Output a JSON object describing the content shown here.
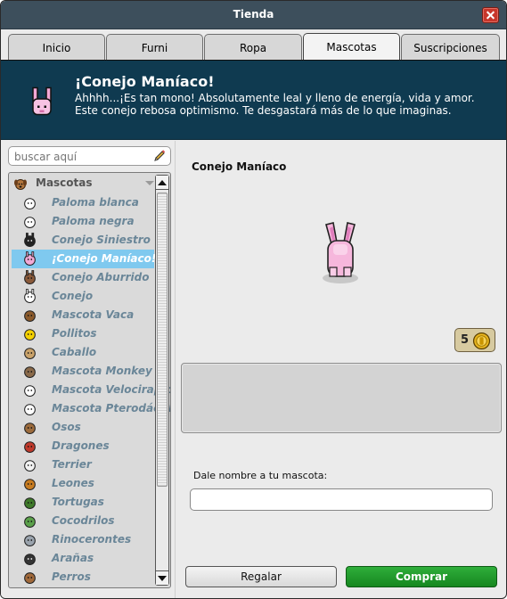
{
  "window": {
    "title": "Tienda"
  },
  "tabs": [
    {
      "label": "Inicio"
    },
    {
      "label": "Furni"
    },
    {
      "label": "Ropa"
    },
    {
      "label": "Mascotas"
    },
    {
      "label": "Suscripciones"
    }
  ],
  "active_tab": "Mascotas",
  "banner": {
    "title": "¡Conejo Maníaco!",
    "description": "Ahhhh...¡Es tan mono! Absolutamente leal y lleno de energía, vida y amor. Este conejo rebosa optimismo. Te desgastará más de lo que imaginas.",
    "icon": "pink-rabbit-icon"
  },
  "search": {
    "placeholder": "buscar aquí",
    "icon": "pencil-icon"
  },
  "category": {
    "label": "Mascotas",
    "icon": "dog-face-icon"
  },
  "items": [
    {
      "label": "Paloma blanca",
      "icon": "white-dove-icon",
      "color": "#ffffff"
    },
    {
      "label": "Paloma negra",
      "icon": "black-dove-icon",
      "color": "#ffffff"
    },
    {
      "label": "Conejo Siniestro",
      "icon": "black-rabbit-icon",
      "color": "#222222"
    },
    {
      "label": "¡Conejo Maníaco!",
      "icon": "pink-rabbit-icon",
      "color": "#f2a9d6",
      "selected": true
    },
    {
      "label": "Conejo Aburrido",
      "icon": "brown-rabbit-icon",
      "color": "#8a5a3a"
    },
    {
      "label": "Conejo",
      "icon": "white-rabbit-icon",
      "color": "#ffffff"
    },
    {
      "label": "Mascota Vaca",
      "icon": "cow-icon",
      "color": "#8b5a2b"
    },
    {
      "label": "Pollitos",
      "icon": "chick-icon",
      "color": "#f4d000"
    },
    {
      "label": "Caballo",
      "icon": "horse-icon",
      "color": "#c9a26a"
    },
    {
      "label": "Mascota Monkey",
      "icon": "monkey-icon",
      "color": "#8a6a4a"
    },
    {
      "label": "Mascota Velociraptor",
      "icon": "velociraptor-icon",
      "color": "#ffffff"
    },
    {
      "label": "Mascota Pterodáctilo",
      "icon": "pterodactyl-icon",
      "color": "#ffffff"
    },
    {
      "label": "Osos",
      "icon": "bear-icon",
      "color": "#9c6b3c"
    },
    {
      "label": "Dragones",
      "icon": "dragon-icon",
      "color": "#c0392b"
    },
    {
      "label": "Terrier",
      "icon": "terrier-icon",
      "color": "#f2f2f2"
    },
    {
      "label": "Leones",
      "icon": "lion-icon",
      "color": "#c77b20"
    },
    {
      "label": "Tortugas",
      "icon": "turtle-icon",
      "color": "#3f7a2a"
    },
    {
      "label": "Cocodrilos",
      "icon": "crocodile-icon",
      "color": "#5aa04a"
    },
    {
      "label": "Rinocerontes",
      "icon": "rhino-icon",
      "color": "#9aa3ad"
    },
    {
      "label": "Arañas",
      "icon": "spider-icon",
      "color": "#333333"
    },
    {
      "label": "Perros",
      "icon": "dog-icon",
      "color": "#a0693a"
    }
  ],
  "product": {
    "name": "Conejo Maníaco",
    "price": "5",
    "price_icon": "credits-coin-icon",
    "pet_name_label": "Dale nombre a tu mascota:",
    "pet_name_value": ""
  },
  "buttons": {
    "gift": "Regalar",
    "buy": "Comprar"
  },
  "colors": {
    "banner": "#0f3a50",
    "selected_row": "#7fc9ef",
    "buy_button": "#1f9b2b",
    "close_button": "#c7362b"
  }
}
